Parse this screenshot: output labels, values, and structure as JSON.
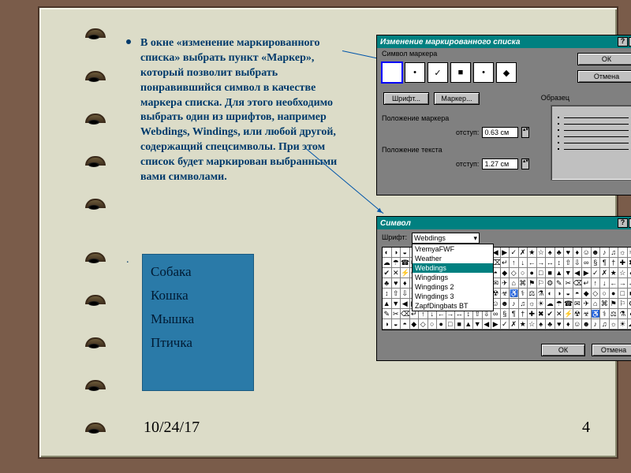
{
  "main_text": "В окне «изменение маркированного списка» выбрать пункт «Маркер», который позволит выбрать понравившийся символ в качестве маркера списка. Для этого необходимо выбрать один из шрифтов, например Webdings, Windings, или любой другой, содержащий спецсимволы. При этом список будет маркирован выбранными вами символами.",
  "example_list": [
    "Собака",
    "Кошка",
    "Мышка",
    "Птичка"
  ],
  "date": "10/24/17",
  "page_number": "4",
  "dialog1": {
    "title": "Изменение маркированного списка",
    "group_symbol": "Символ маркера",
    "markers": [
      "",
      "•",
      "✓",
      "■",
      "•",
      "◆"
    ],
    "btn_font": "Шрифт...",
    "btn_marker": "Маркер...",
    "btn_ok": "ОК",
    "btn_cancel": "Отмена",
    "group_sample": "Образец",
    "group_pos_marker": "Положение маркера",
    "group_pos_text": "Положение текста",
    "lbl_indent": "отступ:",
    "val_marker_indent": "0.63 см",
    "val_text_indent": "1.27 см"
  },
  "dialog2": {
    "title": "Символ",
    "lbl_font": "Шрифт:",
    "selected_font": "Webdings",
    "font_options": [
      "VremyaFWF",
      "Weather",
      "Webdings",
      "Wingdings",
      "Wingdings 2",
      "Wingdings 3",
      "ZapfDingbats BT"
    ],
    "btn_ok": "ОК",
    "btn_cancel": "Отмена"
  }
}
